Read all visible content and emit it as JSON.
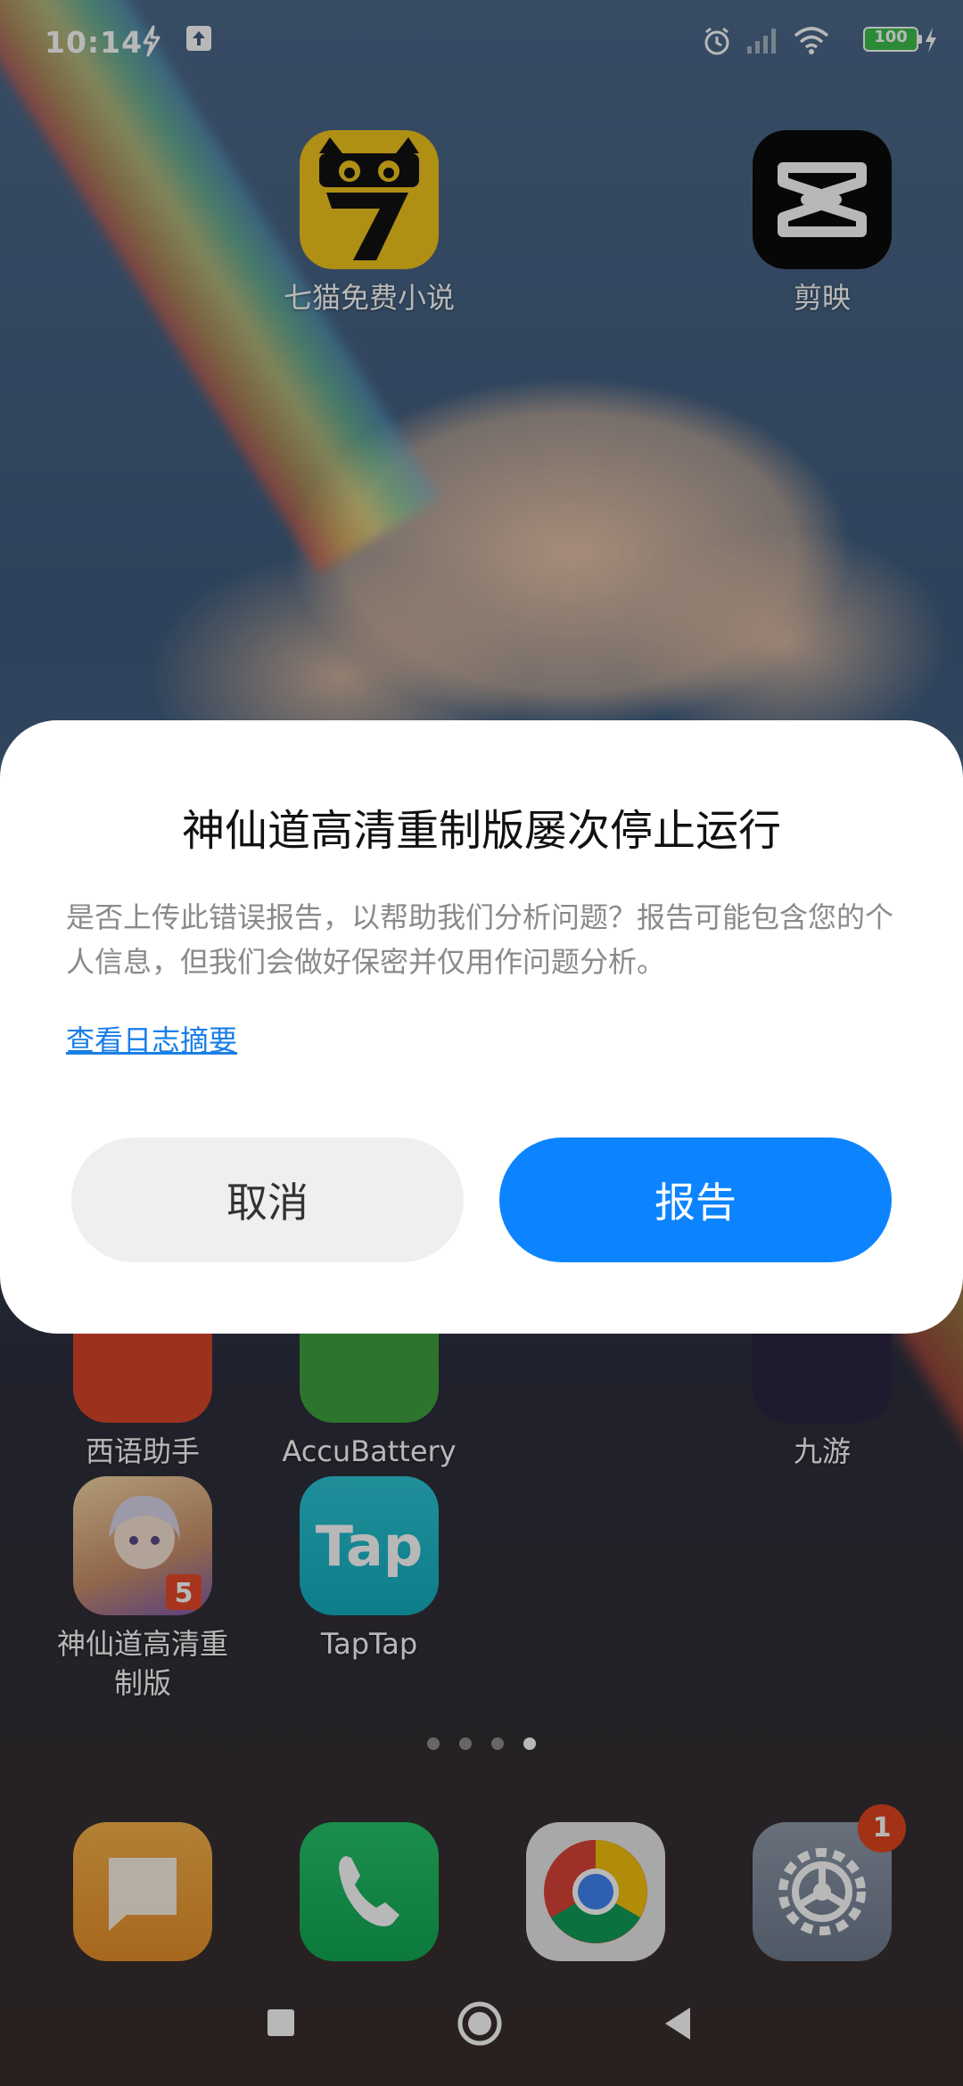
{
  "status_bar": {
    "time": "10:14",
    "battery_level": "100",
    "icons": [
      "lightning-notification-icon",
      "upload-icon",
      "alarm-icon",
      "signal-icon",
      "wifi-icon",
      "battery-icon",
      "charging-icon"
    ]
  },
  "home": {
    "top_apps": [
      {
        "label": "七猫免费小说",
        "icon": "qimao-cat-icon"
      },
      {
        "label": "剪映",
        "icon": "capcut-icon"
      }
    ],
    "row_apps": [
      {
        "label": "西语助手"
      },
      {
        "label": "AccuBattery"
      },
      {
        "label": "九游"
      }
    ],
    "bottom_apps": [
      {
        "label": "神仙道高清重制版",
        "icon": "game-character-icon"
      },
      {
        "label": "TapTap",
        "icon_text": "Tap"
      }
    ],
    "page_count": 4,
    "active_page": 4
  },
  "dock": {
    "apps": [
      "messages-icon",
      "phone-icon",
      "chrome-icon",
      "settings-icon"
    ],
    "settings_badge": "1"
  },
  "dialog": {
    "title": "神仙道高清重制版屡次停止运行",
    "message": "是否上传此错误报告，以帮助我们分析问题？报告可能包含您的个人信息，但我们会做好保密并仅用作问题分析。",
    "link": "查看日志摘要",
    "cancel_label": "取消",
    "report_label": "报告"
  },
  "colors": {
    "accent": "#0d84ff",
    "link": "#1a7fe6",
    "cancel_bg": "#efefef",
    "badge": "#e2451e"
  }
}
